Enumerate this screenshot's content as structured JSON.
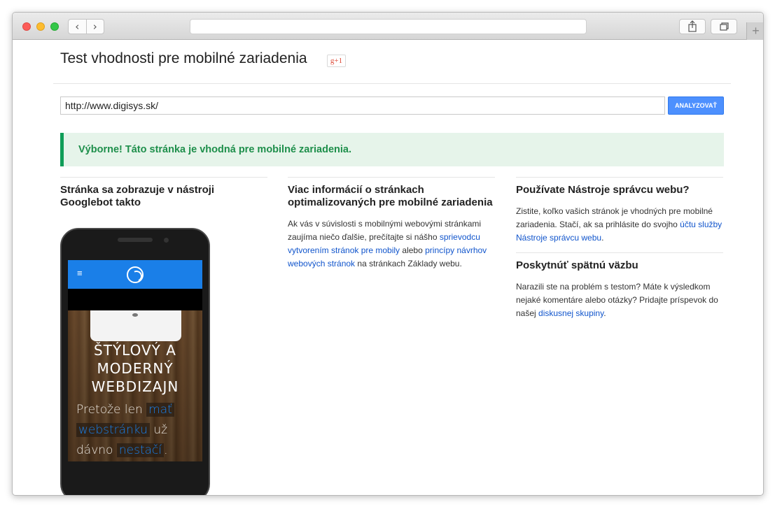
{
  "browser": {
    "back_label": "‹",
    "forward_label": "›",
    "url_bar": "",
    "new_tab_label": "+"
  },
  "page": {
    "title": "Test vhodnosti pre mobilné zariadenia",
    "gplus_label": "g+1",
    "url_value": "http://www.digisys.sk/",
    "analyze_label": "ANALYZOVAŤ",
    "result_banner": "Výborne! Táto stránka je vhodná pre mobilné zariadenia."
  },
  "col1": {
    "title": "Stránka sa zobrazuje v nástroji Googlebot takto"
  },
  "phone_preview": {
    "menu_glyph": "≡",
    "headline": [
      "ŠTÝLOVÝ A",
      "MODERNÝ",
      "WEBDIZAJN"
    ],
    "sub_plain_1": "Pretože len",
    "sub_hl_1": "mať",
    "sub_hl_2": "webstránku",
    "sub_plain_2": "už",
    "sub_plain_3": "dávno",
    "sub_hl_3": "nestačí",
    "sub_dot": "."
  },
  "col2": {
    "title": "Viac informácií o stránkach optimalizovaných pre mobilné zariadenia",
    "text_1": "Ak vás v súvislosti s mobilnými webovými stránkami zaujíma niečo ďalšie, prečítajte si nášho",
    "link_1": "sprievodcu vytvorením stránok pre mobily",
    "text_2": "alebo",
    "link_2": "princípy návrhov webových stránok",
    "text_3": "na stránkach Základy webu."
  },
  "col3": {
    "title": "Používate Nástroje správcu webu?",
    "text_1": "Zistite, koľko vašich stránok je vhodných pre mobilné zariadenia. Stačí, ak sa prihlásite do svojho",
    "link_1": "účtu služby Nástroje správcu webu",
    "text_2": ".",
    "feedback_title": "Poskytnúť spätnú väzbu",
    "feedback_text": "Narazili ste na problém s testom? Máte k výsledkom nejaké komentáre alebo otázky? Pridajte príspevok do našej",
    "feedback_link": "diskusnej skupiny",
    "feedback_end": "."
  },
  "colors": {
    "accent_blue": "#4d90fe",
    "success_green": "#1e8f4b",
    "link": "#1155cc"
  }
}
